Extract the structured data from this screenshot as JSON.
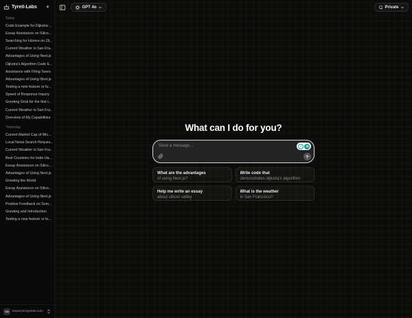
{
  "sidebar": {
    "brand": "Tyrell-Labs",
    "new_chat_label": "+",
    "sections": [
      {
        "label": "Today",
        "items": [
          "Code Example for Dijkstra'...",
          "Essay Assistance on Silico...",
          "Searching for Homes on Zil...",
          "Current Weather in San Fra...",
          "Advantages of Using Next.js",
          "Dijkstra's Algorithm Code E...",
          "Assistance with Filing Taxes",
          "Advantages of Using Next.js",
          "Testing a new feature or fu...",
          "Speed of Response Inquiry",
          "Greeting Grok for the first t...",
          "Current Weather in San Fra...",
          "Overview of My Capabilities"
        ]
      },
      {
        "label": "Yesterday",
        "items": [
          "Current Market Cap of Mic...",
          "Local News Search Reques...",
          "Current Weather in San Fra...",
          "Best Countries for Indie Ha...",
          "Essay Assistance on Silico...",
          "Advantages of Using Next.js",
          "Greeting the World",
          "Essay Assistance on Silico...",
          "Advantages of Using Next.js",
          "Positive Feedback on Som...",
          "Greeting and Introduction",
          "Testing a new feature or fu..."
        ]
      }
    ],
    "user": {
      "initials": "CN",
      "email": "klaas@forgebits.com"
    }
  },
  "toolbar": {
    "model_label": "GPT 4o",
    "privacy_label": "Private"
  },
  "hero": {
    "title": "What can I do for you?",
    "input_placeholder": "Send a message...",
    "suggestions": [
      {
        "title": "What are the advantages",
        "subtitle": "of using Next.js?"
      },
      {
        "title": "Write code that",
        "subtitle": "demonstrates dijkstra's algorithm"
      },
      {
        "title": "Help me write an essay",
        "subtitle": "about silicon valley"
      },
      {
        "title": "What is the weather",
        "subtitle": "in San Francisco?"
      }
    ]
  },
  "colors": {
    "accent_teal": "#0d9f8e",
    "input_border": "#d9d9d9"
  }
}
